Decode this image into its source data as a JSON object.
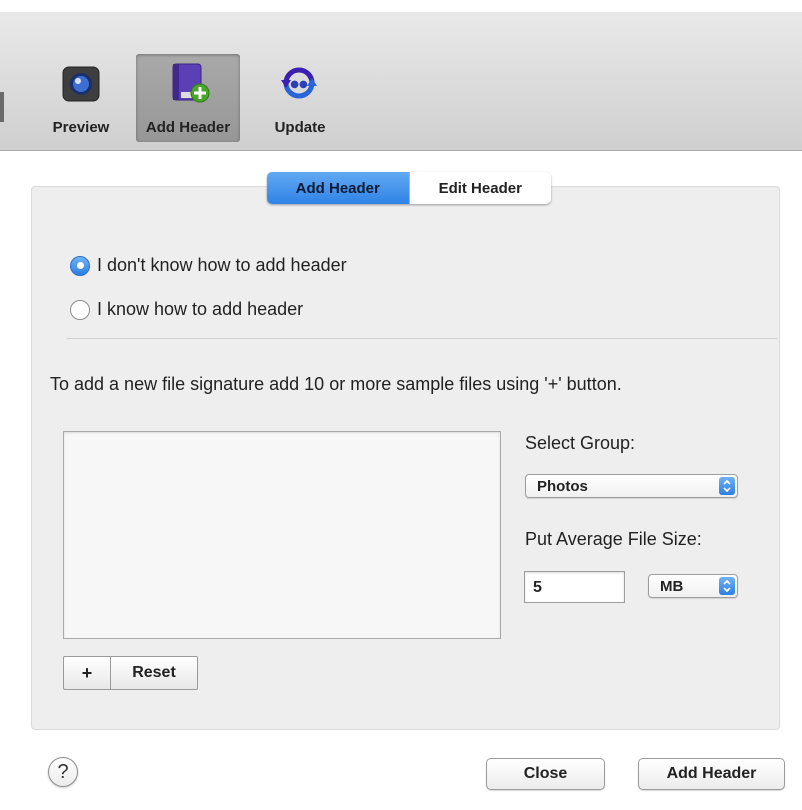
{
  "toolbar": {
    "items": [
      {
        "label": "Preview",
        "icon": "preview-icon"
      },
      {
        "label": "Add Header",
        "icon": "add-header-icon",
        "selected": true
      },
      {
        "label": "Update",
        "icon": "update-icon"
      }
    ]
  },
  "tabs": {
    "add_header": "Add Header",
    "edit_header": "Edit Header",
    "active": "Add Header"
  },
  "options": {
    "dont_know": "I don't know how to add header",
    "know": "I know how to add header",
    "selected": "I don't know how to add header"
  },
  "instructions": "To add a new file signature add 10 or more sample files using '+' button.",
  "file_list": {
    "items": [],
    "add_label": "+",
    "reset_label": "Reset"
  },
  "group": {
    "label": "Select Group:",
    "value": "Photos"
  },
  "file_size": {
    "label": "Put Average File Size:",
    "value": "5",
    "unit": "MB"
  },
  "footer": {
    "help_label": "?",
    "close_label": "Close",
    "add_header_label": "Add Header"
  },
  "colors": {
    "accent": "#3a8ce8"
  }
}
